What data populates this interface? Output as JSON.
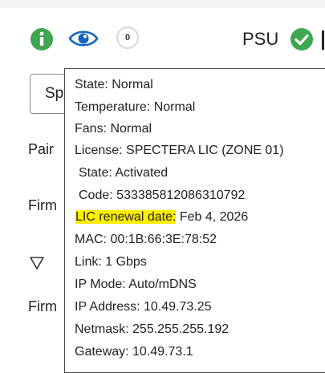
{
  "toolbar": {
    "info_icon": "info-icon",
    "eye_icon": "eye-icon",
    "count": "0",
    "psu_label": "PSU",
    "psu_status_icon": "check-circle-icon"
  },
  "colors": {
    "info_green": "#3fa652",
    "eye_blue": "#1565c0",
    "psu_green": "#3fa652",
    "highlight": "#ffee00"
  },
  "sidebar": {
    "dropdown_value": "Sp",
    "pair_label": "Pair",
    "firmware_label_1": "Firm",
    "filter_icon": "filter-icon",
    "firmware_label_2": "Firm"
  },
  "tooltip": {
    "state": "State: Normal",
    "temperature": "Temperature: Normal",
    "fans": "Fans: Normal",
    "license": "License: SPECTERA LIC (ZONE 01)",
    "license_state": "State: Activated",
    "license_code": "Code: 533385812086310792",
    "renewal_label": "LIC renewal date:",
    "renewal_value": " Feb 4, 2026",
    "mac": "MAC: 00:1B:66:3E:78:52",
    "link": "Link: 1 Gbps",
    "ip_mode": "IP Mode: Auto/mDNS",
    "ip_address": "IP Address: 10.49.73.25",
    "netmask": "Netmask: 255.255.255.192",
    "gateway": "Gateway: 10.49.73.1"
  }
}
